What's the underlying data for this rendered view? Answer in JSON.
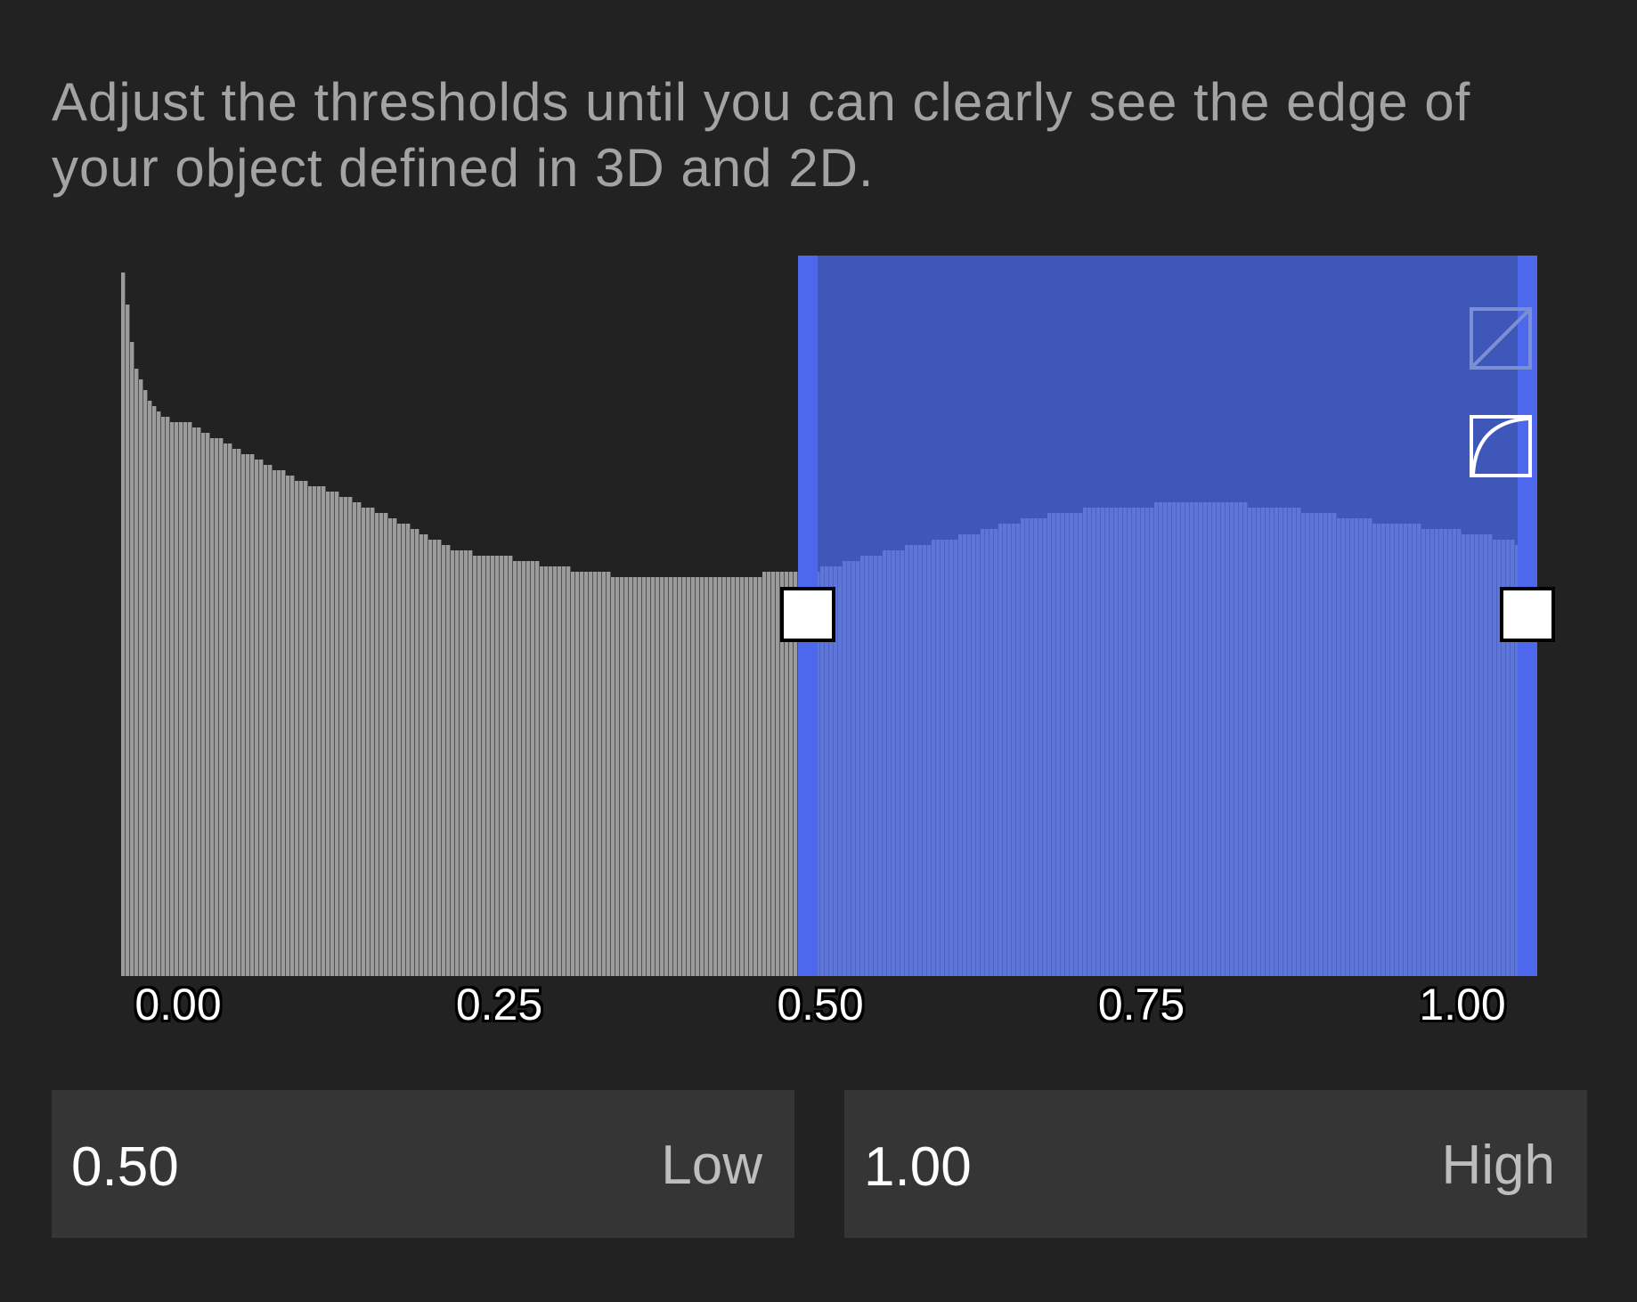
{
  "instructions": "Adjust the thresholds until you can clearly see the edge of your object defined in 3D and 2D.",
  "colors": {
    "background": "#222222",
    "bars": "#9b9b9b",
    "selection_fill": "#3f57b9",
    "selection_bars": "#5e76d8",
    "selection_edge": "#4d68ec",
    "field_background": "#353535"
  },
  "chart_data": {
    "type": "bar",
    "x_ticks": [
      "0.00",
      "0.25",
      "0.50",
      "0.75",
      "1.00"
    ],
    "xlim": [
      0,
      1
    ],
    "ylim": [
      0,
      1
    ],
    "selection": {
      "low": 0.5,
      "high": 1.0
    },
    "histogram_profile": [
      {
        "x": 0.0,
        "y": 1.0
      },
      {
        "x": 0.01,
        "y": 0.85
      },
      {
        "x": 0.02,
        "y": 0.8
      },
      {
        "x": 0.03,
        "y": 0.775
      },
      {
        "x": 0.05,
        "y": 0.765
      },
      {
        "x": 0.08,
        "y": 0.735
      },
      {
        "x": 0.12,
        "y": 0.695
      },
      {
        "x": 0.16,
        "y": 0.665
      },
      {
        "x": 0.2,
        "y": 0.63
      },
      {
        "x": 0.24,
        "y": 0.59
      },
      {
        "x": 0.28,
        "y": 0.58
      },
      {
        "x": 0.32,
        "y": 0.565
      },
      {
        "x": 0.36,
        "y": 0.555
      },
      {
        "x": 0.4,
        "y": 0.555
      },
      {
        "x": 0.44,
        "y": 0.555
      },
      {
        "x": 0.48,
        "y": 0.56
      },
      {
        "x": 0.5,
        "y": 0.565
      },
      {
        "x": 0.55,
        "y": 0.59
      },
      {
        "x": 0.6,
        "y": 0.61
      },
      {
        "x": 0.65,
        "y": 0.635
      },
      {
        "x": 0.7,
        "y": 0.65
      },
      {
        "x": 0.75,
        "y": 0.655
      },
      {
        "x": 0.8,
        "y": 0.655
      },
      {
        "x": 0.85,
        "y": 0.645
      },
      {
        "x": 0.9,
        "y": 0.63
      },
      {
        "x": 0.95,
        "y": 0.62
      },
      {
        "x": 0.98,
        "y": 0.61
      },
      {
        "x": 1.0,
        "y": 0.6
      }
    ]
  },
  "icons": {
    "linear_mode": "linear-curve-icon",
    "curve_mode": "log-curve-icon"
  },
  "fields": {
    "low": {
      "value": "0.50",
      "label": "Low"
    },
    "high": {
      "value": "1.00",
      "label": "High"
    }
  }
}
